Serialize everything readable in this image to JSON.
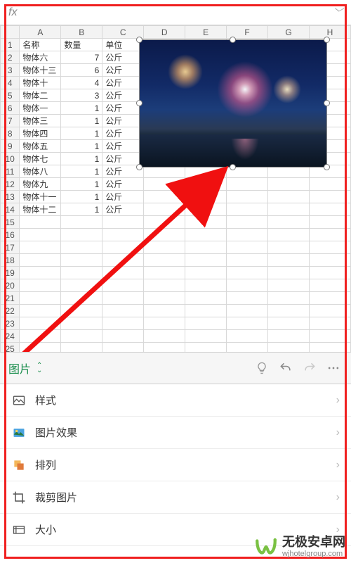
{
  "fx": {
    "label": "fx"
  },
  "sheet": {
    "columns": [
      "A",
      "B",
      "C",
      "D",
      "E",
      "F",
      "G",
      "H"
    ],
    "rowCount": 26,
    "headers": {
      "name": "名称",
      "qty": "数量",
      "unit": "单位"
    },
    "rows": [
      {
        "name": "物体六",
        "qty": 7,
        "unit": "公斤"
      },
      {
        "name": "物体十三",
        "qty": 6,
        "unit": "公斤"
      },
      {
        "name": "物体十",
        "qty": 4,
        "unit": "公斤"
      },
      {
        "name": "物体二",
        "qty": 3,
        "unit": "公斤"
      },
      {
        "name": "物体一",
        "qty": 1,
        "unit": "公斤"
      },
      {
        "name": "物体三",
        "qty": 1,
        "unit": "公斤"
      },
      {
        "name": "物体四",
        "qty": 1,
        "unit": "公斤"
      },
      {
        "name": "物体五",
        "qty": 1,
        "unit": "公斤"
      },
      {
        "name": "物体七",
        "qty": 1,
        "unit": "公斤"
      },
      {
        "name": "物体八",
        "qty": 1,
        "unit": "公斤"
      },
      {
        "name": "物体九",
        "qty": 1,
        "unit": "公斤"
      },
      {
        "name": "物体十一",
        "qty": 1,
        "unit": "公斤"
      },
      {
        "name": "物体十二",
        "qty": 1,
        "unit": "公斤"
      }
    ]
  },
  "toolbar": {
    "tab": "图片"
  },
  "menu": {
    "items": [
      {
        "label": "样式",
        "icon": "style-icon"
      },
      {
        "label": "图片效果",
        "icon": "effects-icon"
      },
      {
        "label": "排列",
        "icon": "arrange-icon"
      },
      {
        "label": "裁剪图片",
        "icon": "crop-icon"
      },
      {
        "label": "大小",
        "icon": "size-icon"
      }
    ]
  },
  "watermark": {
    "main": "无极安卓网",
    "sub": "wjhotelgroup.com"
  }
}
